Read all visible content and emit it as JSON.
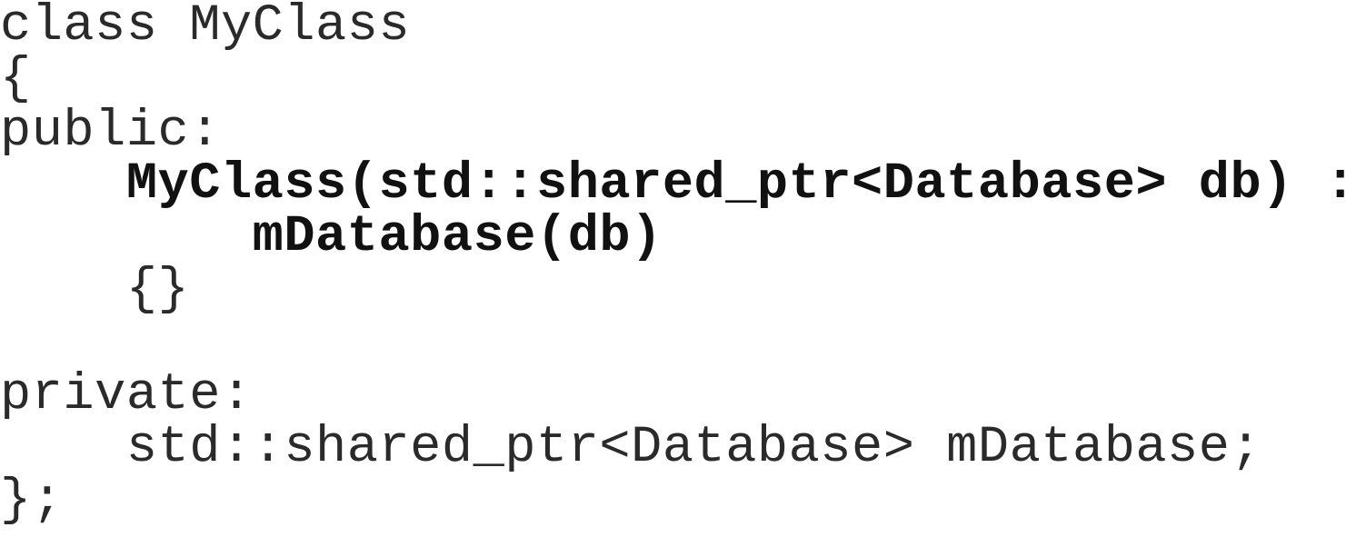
{
  "code": {
    "lines": [
      {
        "text": "class MyClass",
        "bold": false
      },
      {
        "text": "{",
        "bold": false
      },
      {
        "text": "public:",
        "bold": false
      },
      {
        "text": "    MyClass(std::shared_ptr<Database> db) :",
        "bold": true
      },
      {
        "text": "        mDatabase(db)",
        "bold": true
      },
      {
        "text": "    {}",
        "bold": false
      },
      {
        "text": "",
        "bold": false
      },
      {
        "text": "private:",
        "bold": false
      },
      {
        "text": "    std::shared_ptr<Database> mDatabase;",
        "bold": false
      },
      {
        "text": "};",
        "bold": false
      }
    ]
  }
}
